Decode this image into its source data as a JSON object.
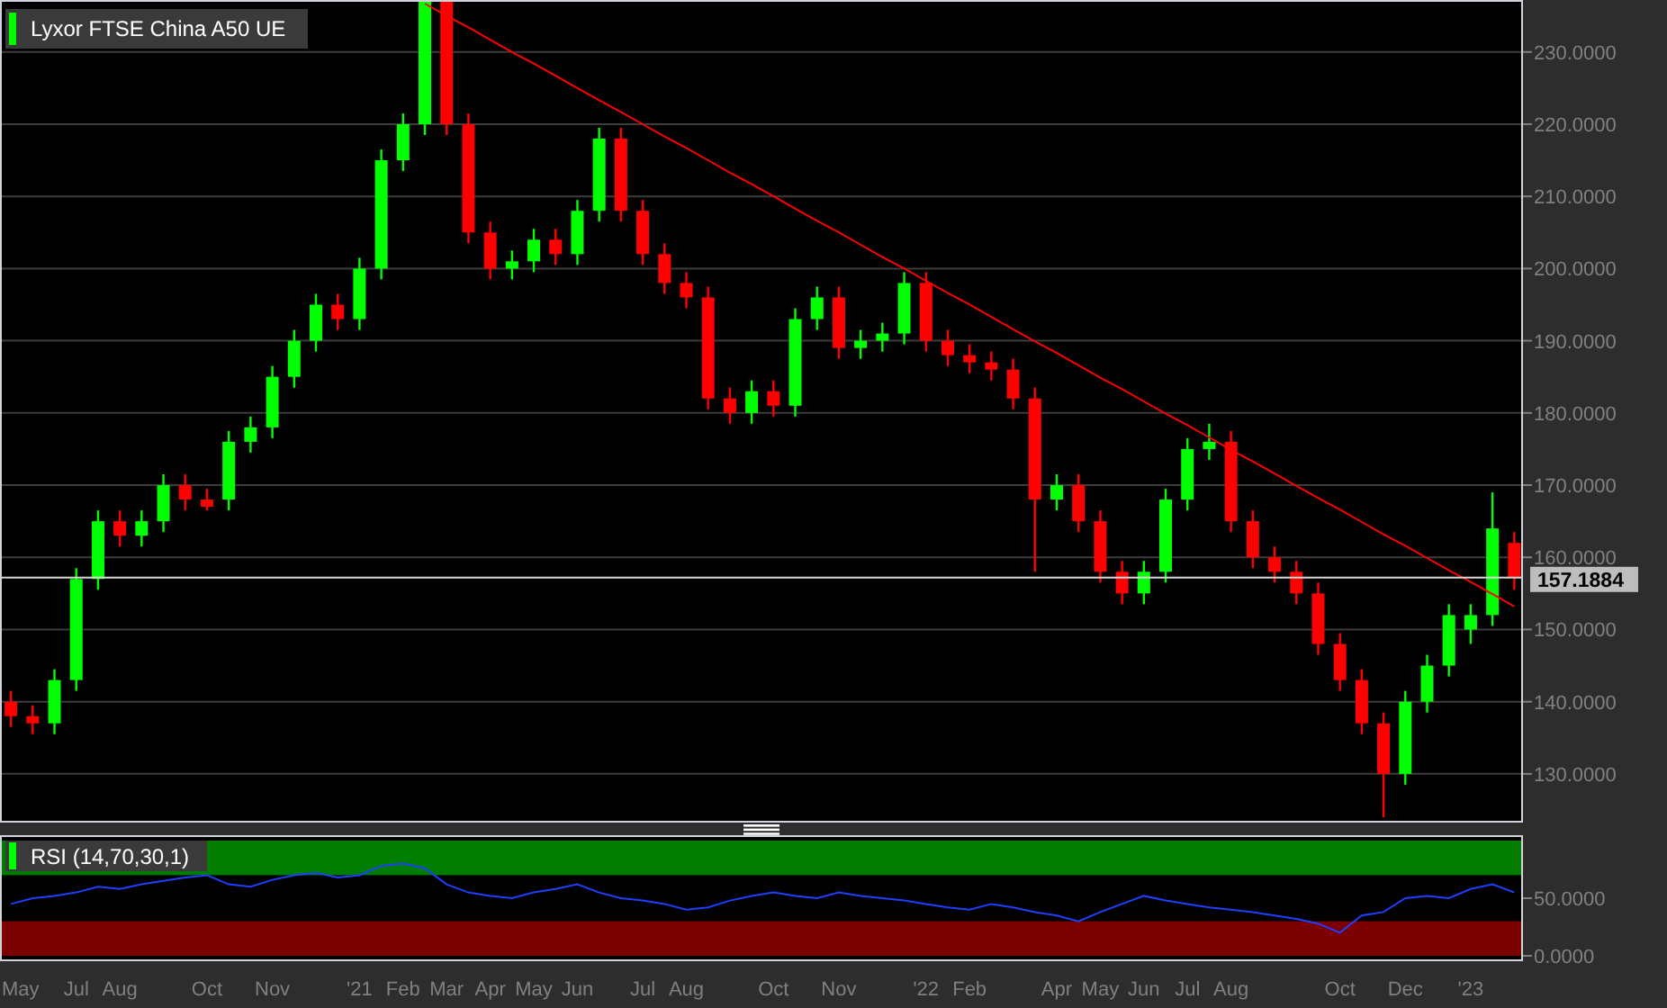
{
  "price_panel": {
    "chart_data": {
      "type": "candlestick",
      "title": "Lyxor FTSE China A50 UE",
      "ylim": [
        123.5,
        237.2
      ],
      "yticks": [
        {
          "value": 130,
          "label": "130.0000"
        },
        {
          "value": 140,
          "label": "140.0000"
        },
        {
          "value": 150,
          "label": "150.0000"
        },
        {
          "value": 160,
          "label": "160.0000"
        },
        {
          "value": 170,
          "label": "170.0000"
        },
        {
          "value": 180,
          "label": "180.0000"
        },
        {
          "value": 190,
          "label": "190.0000"
        },
        {
          "value": 200,
          "label": "200.0000"
        },
        {
          "value": 210,
          "label": "210.0000"
        },
        {
          "value": 220,
          "label": "220.0000"
        },
        {
          "value": 230,
          "label": "230.0000"
        }
      ],
      "ohlc": [
        [
          140,
          141.5,
          136.5,
          138
        ],
        [
          138,
          139.5,
          135.5,
          137
        ],
        [
          137,
          144.5,
          135.5,
          143
        ],
        [
          143,
          158.5,
          141.5,
          157
        ],
        [
          157,
          166.5,
          155.5,
          165
        ],
        [
          165,
          166.5,
          161.5,
          163
        ],
        [
          163,
          166.5,
          161.5,
          165
        ],
        [
          165,
          171.5,
          163.5,
          170
        ],
        [
          170,
          171.5,
          166.5,
          168
        ],
        [
          168,
          169.5,
          166.5,
          167
        ],
        [
          168,
          177.5,
          166.5,
          176
        ],
        [
          176,
          179.5,
          174.5,
          178
        ],
        [
          178,
          186.5,
          176.5,
          185
        ],
        [
          185,
          191.5,
          183.5,
          190
        ],
        [
          190,
          196.5,
          188.5,
          195
        ],
        [
          195,
          196.5,
          191.5,
          193
        ],
        [
          193,
          201.5,
          191.5,
          200
        ],
        [
          200,
          216.5,
          198.5,
          215
        ],
        [
          215,
          221.5,
          213.5,
          220
        ],
        [
          220,
          237,
          218.5,
          237
        ],
        [
          237,
          237,
          218.5,
          220
        ],
        [
          220,
          221.5,
          203.5,
          205
        ],
        [
          205,
          206.5,
          198.5,
          200
        ],
        [
          200,
          202.5,
          198.5,
          201
        ],
        [
          201,
          205.5,
          199.5,
          204
        ],
        [
          204,
          205.5,
          200.5,
          202
        ],
        [
          202,
          209.5,
          200.5,
          208
        ],
        [
          208,
          219.5,
          206.5,
          218
        ],
        [
          218,
          219.5,
          206.5,
          208
        ],
        [
          208,
          209.5,
          200.5,
          202
        ],
        [
          202,
          203.5,
          196.5,
          198
        ],
        [
          198,
          199.5,
          194.5,
          196
        ],
        [
          196,
          197.5,
          180.5,
          182
        ],
        [
          182,
          183.5,
          178.5,
          180
        ],
        [
          180,
          184.5,
          178.5,
          183
        ],
        [
          183,
          184.5,
          179.5,
          181
        ],
        [
          181,
          194.5,
          179.5,
          193
        ],
        [
          193,
          197.5,
          191.5,
          196
        ],
        [
          196,
          197.5,
          187.5,
          189
        ],
        [
          189,
          191.5,
          187.5,
          190
        ],
        [
          190,
          192.5,
          188.5,
          191
        ],
        [
          191,
          199.5,
          189.5,
          198
        ],
        [
          198,
          199.5,
          188.5,
          190
        ],
        [
          190,
          191.5,
          186.5,
          188
        ],
        [
          188,
          189.5,
          185.5,
          187
        ],
        [
          187,
          188.5,
          184.5,
          186
        ],
        [
          186,
          187.5,
          180.5,
          182
        ],
        [
          182,
          183.5,
          158,
          168
        ],
        [
          168,
          171.5,
          166.5,
          170
        ],
        [
          170,
          171.5,
          163.5,
          165
        ],
        [
          165,
          166.5,
          156.5,
          158
        ],
        [
          158,
          159.5,
          153.5,
          155
        ],
        [
          155,
          159.5,
          153.5,
          158
        ],
        [
          158,
          169.5,
          156.5,
          168
        ],
        [
          168,
          176.5,
          166.5,
          175
        ],
        [
          175,
          178.5,
          173.5,
          176
        ],
        [
          176,
          177.5,
          163.5,
          165
        ],
        [
          165,
          166.5,
          158.5,
          160
        ],
        [
          160,
          161.5,
          156.5,
          158
        ],
        [
          158,
          159.5,
          153.5,
          155
        ],
        [
          155,
          156.5,
          146.5,
          148
        ],
        [
          148,
          149.5,
          141.5,
          143
        ],
        [
          143,
          144.5,
          135.5,
          137
        ],
        [
          137,
          138.5,
          124,
          130
        ],
        [
          130,
          141.5,
          128.5,
          140
        ],
        [
          140,
          146.5,
          138.5,
          145
        ],
        [
          145,
          153.5,
          143.5,
          152
        ],
        [
          150,
          153.5,
          148,
          152
        ],
        [
          152,
          169,
          150.5,
          164
        ],
        [
          162,
          163.5,
          155.5,
          157.2
        ]
      ],
      "series": [
        {
          "type": "line",
          "color": "#ff0000",
          "values": [
            null,
            null,
            null,
            null,
            null,
            null,
            null,
            null,
            null,
            null,
            null,
            null,
            null,
            null,
            null,
            null,
            null,
            null,
            null,
            236.7,
            235.0,
            233.4,
            231.7,
            230.0,
            228.4,
            226.7,
            225.0,
            223.3,
            221.7,
            220.0,
            218.3,
            216.7,
            215.0,
            213.3,
            211.7,
            210.0,
            208.3,
            206.6,
            205.0,
            203.3,
            201.6,
            200.0,
            198.3,
            196.6,
            195.0,
            193.3,
            191.6,
            189.9,
            188.3,
            186.6,
            184.9,
            183.3,
            181.6,
            179.9,
            178.3,
            176.6,
            174.9,
            173.3,
            171.6,
            169.9,
            168.2,
            166.6,
            164.9,
            163.2,
            161.6,
            159.9,
            158.2,
            156.6,
            154.9,
            153.2
          ]
        }
      ],
      "ref_lines": [
        {
          "axis": "y",
          "value": 157.1884,
          "label": "157.1884"
        }
      ],
      "grid": true
    }
  },
  "rsi_panel": {
    "chart_data": {
      "type": "line",
      "title": "RSI (14,70,30,1)",
      "categories": [
        "May",
        null,
        null,
        "Jul",
        null,
        "Aug",
        null,
        null,
        null,
        "Oct",
        null,
        null,
        "Nov",
        null,
        null,
        null,
        "'21",
        null,
        "Feb",
        null,
        "Mar",
        null,
        "Apr",
        null,
        "May",
        null,
        "Jun",
        null,
        null,
        "Jul",
        null,
        "Aug",
        null,
        null,
        null,
        "Oct",
        null,
        null,
        "Nov",
        null,
        null,
        null,
        "'22",
        null,
        "Feb",
        null,
        null,
        null,
        "Apr",
        null,
        "May",
        null,
        "Jun",
        null,
        "Jul",
        null,
        "Aug",
        null,
        null,
        null,
        null,
        "Oct",
        null,
        null,
        "Dec",
        null,
        null,
        "'23",
        null,
        null
      ],
      "ylim": [
        0,
        100
      ],
      "yticks": [
        {
          "value": 50,
          "label": "50.0000"
        },
        {
          "value": 0,
          "label": "0.0000"
        }
      ],
      "series": [
        {
          "color": "#1f3fff",
          "values": [
            45,
            50,
            52,
            55,
            60,
            58,
            62,
            65,
            68,
            70,
            62,
            60,
            66,
            70,
            72,
            68,
            70,
            78,
            80,
            76,
            62,
            55,
            52,
            50,
            55,
            58,
            62,
            55,
            50,
            48,
            45,
            40,
            42,
            48,
            52,
            55,
            52,
            50,
            55,
            52,
            50,
            48,
            45,
            42,
            40,
            45,
            42,
            38,
            35,
            30,
            38,
            45,
            52,
            48,
            45,
            42,
            40,
            38,
            35,
            32,
            28,
            20,
            35,
            38,
            50,
            52,
            50,
            58,
            62,
            55
          ]
        }
      ],
      "bands": [
        {
          "axis": "y",
          "from": 70,
          "to": 100,
          "color": "#007c00"
        },
        {
          "axis": "y",
          "from": 0,
          "to": 30,
          "color": "#7c0000"
        }
      ]
    }
  }
}
